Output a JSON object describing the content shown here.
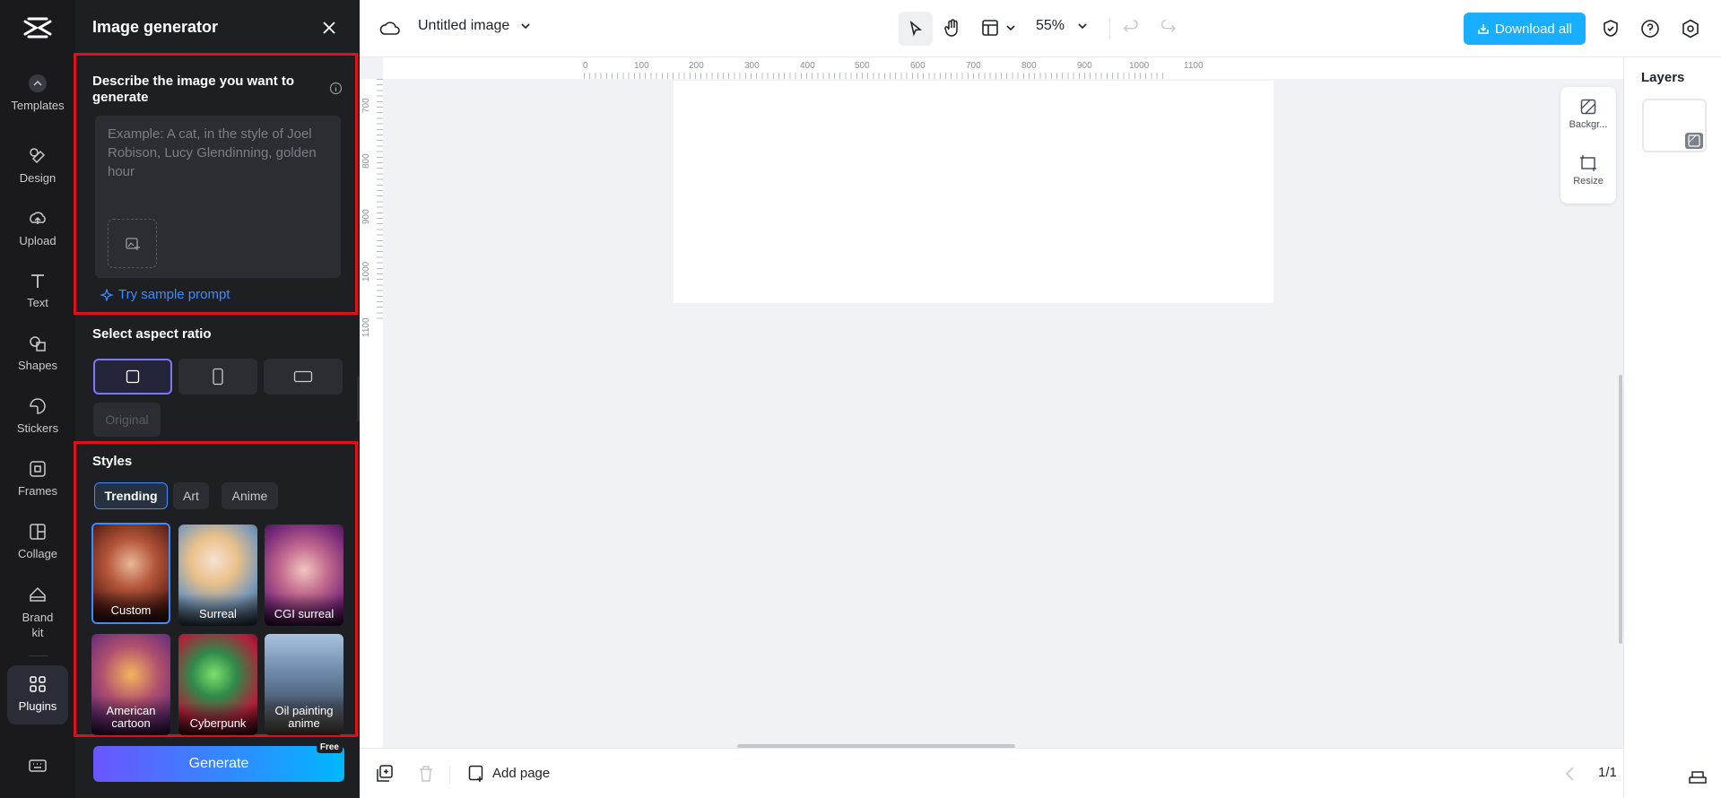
{
  "rail": {
    "items": [
      {
        "label": "Templates",
        "icon": "templates-icon"
      },
      {
        "label": "Design",
        "icon": "design-icon"
      },
      {
        "label": "Upload",
        "icon": "upload-icon"
      },
      {
        "label": "Text",
        "icon": "text-icon"
      },
      {
        "label": "Shapes",
        "icon": "shapes-icon"
      },
      {
        "label": "Stickers",
        "icon": "stickers-icon"
      },
      {
        "label": "Frames",
        "icon": "frames-icon"
      },
      {
        "label": "Collage",
        "icon": "collage-icon"
      },
      {
        "label": "Brand kit",
        "icon": "brand-kit-icon"
      },
      {
        "label": "Plugins",
        "icon": "plugins-icon"
      }
    ]
  },
  "panel": {
    "title": "Image generator",
    "prompt_label": "Describe the image you want to generate",
    "prompt_placeholder": "Example: A cat, in the style of Joel Robison, Lucy Glendinning, golden hour",
    "sample_prompt": "Try sample prompt",
    "aspect_title": "Select aspect ratio",
    "original_label": "Original",
    "styles_title": "Styles",
    "style_tabs": [
      "Trending",
      "Art",
      "Anime"
    ],
    "styles": [
      {
        "label": "Custom"
      },
      {
        "label": "Surreal"
      },
      {
        "label": "CGI surreal"
      },
      {
        "label": "American cartoon"
      },
      {
        "label": "Cyberpunk"
      },
      {
        "label": "Oil painting anime"
      }
    ],
    "generate_label": "Generate",
    "free_badge": "Free"
  },
  "topbar": {
    "doc_title": "Untitled image",
    "zoom": "55%",
    "download_label": "Download all"
  },
  "canvas": {
    "ruler_h": [
      "0",
      "100",
      "200",
      "300",
      "400",
      "500",
      "600",
      "700",
      "800",
      "900",
      "1000",
      "1100"
    ],
    "ruler_v": [
      "700",
      "800",
      "900",
      "1000",
      "1100"
    ],
    "float_background": "Backgr...",
    "float_resize": "Resize"
  },
  "bottombar": {
    "add_page": "Add page",
    "page_indicator": "1/1"
  },
  "layers": {
    "title": "Layers"
  },
  "colors": {
    "accent": "#19aeff",
    "highlight_box": "#e0101a",
    "link": "#3d8bff"
  }
}
